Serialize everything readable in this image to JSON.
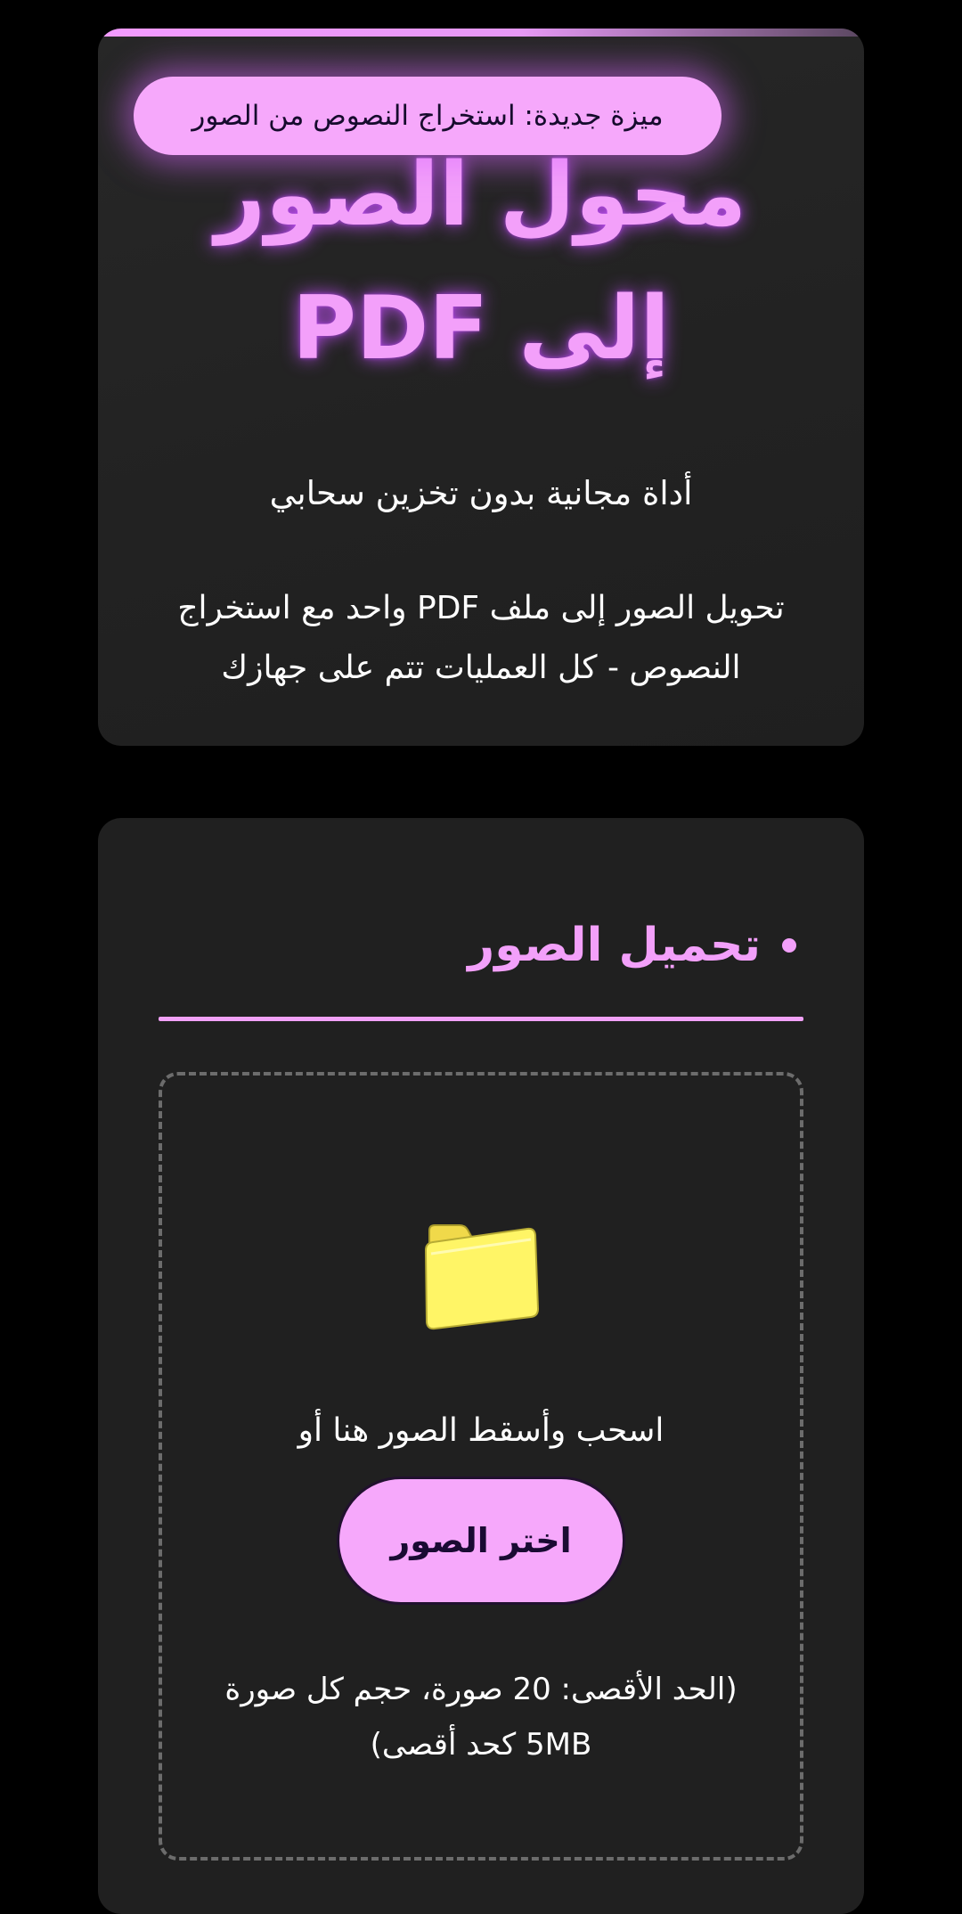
{
  "hero": {
    "badge": "ميزة جديدة: استخراج النصوص من الصور",
    "title": "محول الصور إلى PDF",
    "subtitle": "أداة مجانية بدون تخزين سحابي",
    "description": "تحويل الصور إلى ملف PDF واحد مع استخراج النصوص - كل العمليات تتم على جهازك"
  },
  "upload": {
    "heading": "تحميل الصور",
    "drop_text": "اسحب وأسقط الصور هنا أو",
    "button_label": "اختر الصور",
    "limits": "(الحد الأقصى: 20 صورة، حجم كل صورة 5MB كحد أقصى)",
    "folder_icon": "folder-icon"
  },
  "colors": {
    "accent": "#f3a0fa",
    "button_bg": "#f6a8fb",
    "card_bg": "#202020",
    "page_bg": "#000000",
    "folder": "#fff566"
  }
}
